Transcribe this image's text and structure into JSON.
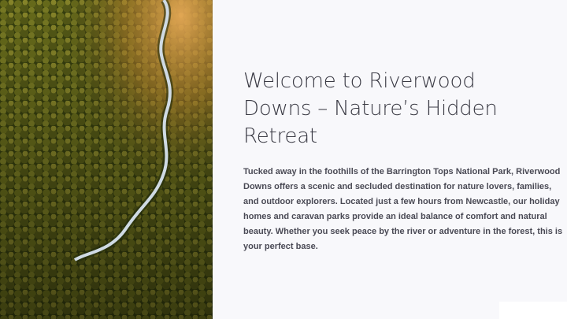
{
  "slide": {
    "image": {
      "description_icon": "forest-river-aerial-photo"
    },
    "title_lines": [
      "Welcome to Riverwood",
      "Downs – Nature’s Hidden",
      "Retreat"
    ],
    "body_lines": [
      "Tucked away in the foothills of the Barrington Tops National Park, Riverwood",
      "Downs offers a scenic and secluded destination for nature lovers, families,",
      "and outdoor explorers. Located just a few hours from Newcastle, our holiday",
      "homes and caravan parks provide an ideal balance of comfort and natural",
      "beauty. Whether you seek peace by the river or adventure in the forest, this is",
      "your perfect base."
    ]
  },
  "colors": {
    "background": "#f8f8fb",
    "title": "#3a3a44",
    "body": "#4a4a55",
    "forest_dark": "#2f3a12",
    "forest_light": "#8a8a2a",
    "river": "#c9d6e2",
    "sunlight": "#e0a24a"
  }
}
